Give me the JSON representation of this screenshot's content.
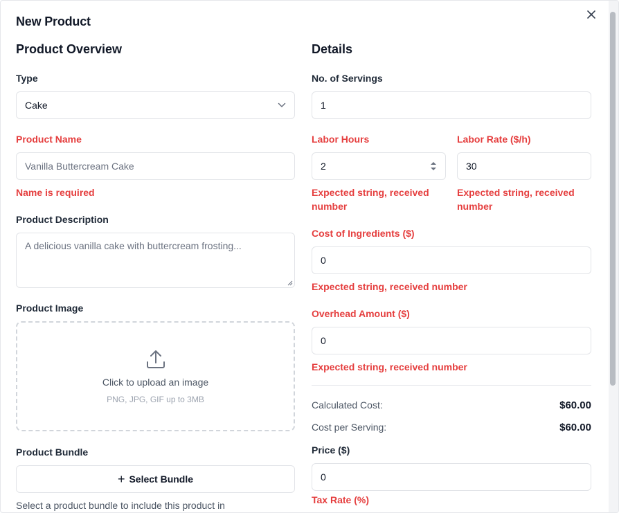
{
  "modal": {
    "title": "New Product",
    "close_icon": "close-icon"
  },
  "overview": {
    "heading": "Product Overview",
    "type": {
      "label": "Type",
      "value": "Cake"
    },
    "name": {
      "label": "Product Name",
      "placeholder": "Vanilla Buttercream Cake",
      "error": "Name is required"
    },
    "description": {
      "label": "Product Description",
      "placeholder": "A delicious vanilla cake with buttercream frosting..."
    },
    "image": {
      "label": "Product Image",
      "upload_text": "Click to upload an image",
      "upload_hint": "PNG, JPG, GIF up to 3MB",
      "icon": "upload-icon"
    },
    "bundle": {
      "label": "Product Bundle",
      "button_label": "Select Bundle",
      "help": "Select a product bundle to include this product in"
    }
  },
  "details": {
    "heading": "Details",
    "servings": {
      "label": "No. of Servings",
      "value": "1"
    },
    "labor_hours": {
      "label": "Labor Hours",
      "value": "2",
      "error_line1": "Expected string, received",
      "error_line2": "number"
    },
    "labor_rate": {
      "label": "Labor Rate ($/h)",
      "value": "30",
      "error_line1": "Expected string, received",
      "error_line2": "number"
    },
    "ingredients": {
      "label": "Cost of Ingredients ($)",
      "value": "0",
      "error": "Expected string, received number"
    },
    "overhead": {
      "label": "Overhead Amount ($)",
      "value": "0",
      "error": "Expected string, received number"
    },
    "calculated_cost": {
      "label": "Calculated Cost:",
      "value": "$60.00"
    },
    "cost_per_serving": {
      "label": "Cost per Serving:",
      "value": "$60.00"
    },
    "price": {
      "label": "Price ($)",
      "value": "0"
    },
    "tax_rate": {
      "label": "Tax Rate (%)"
    }
  },
  "colors": {
    "error": "#e53e3e",
    "border": "#e2e4e8",
    "text": "#111827"
  }
}
